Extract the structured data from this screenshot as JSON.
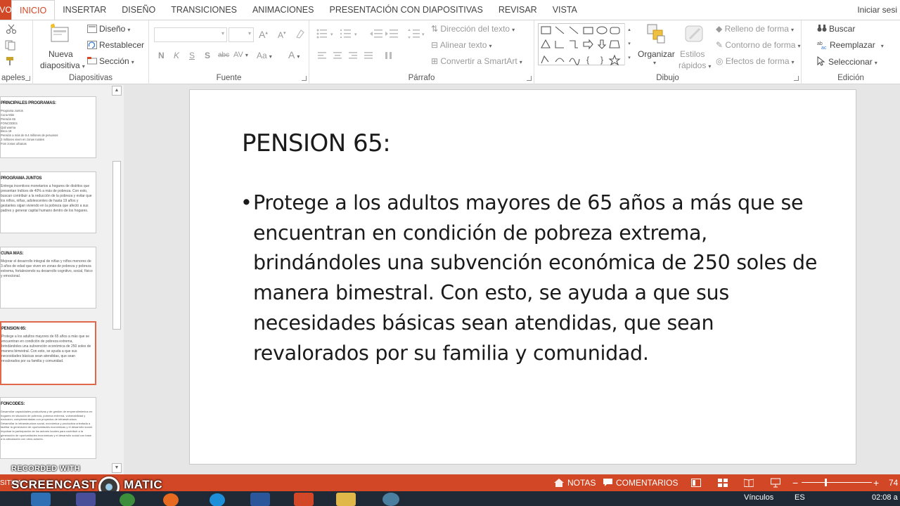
{
  "tabs": {
    "file_label": "VO",
    "items": [
      "INICIO",
      "INSERTAR",
      "DISEÑO",
      "TRANSICIONES",
      "ANIMACIONES",
      "PRESENTACIÓN CON DIAPOSITIVAS",
      "REVISAR",
      "VISTA"
    ],
    "active": "INICIO",
    "signin": "Iniciar sesi"
  },
  "ribbon": {
    "portapapeles": {
      "label": "apeles"
    },
    "diapositivas": {
      "label": "Diapositivas",
      "nueva_line1": "Nueva",
      "nueva_line2": "diapositiva",
      "diseno": "Diseño",
      "restablecer": "Restablecer",
      "seccion": "Sección"
    },
    "fuente": {
      "label": "Fuente",
      "bold": "N",
      "italic": "K",
      "underline": "S",
      "shadow": "S",
      "strike": "abc",
      "spacing": "AV",
      "case": "Aa",
      "color": "A",
      "grow": "A",
      "shrink": "A"
    },
    "parrafo": {
      "label": "Párrafo",
      "direccion": "Dirección del texto",
      "alinear": "Alinear texto",
      "smartart": "Convertir a SmartArt"
    },
    "dibujo": {
      "label": "Dibujo",
      "organizar": "Organizar",
      "estilos1": "Estilos",
      "estilos2": "rápidos",
      "relleno": "Relleno de forma",
      "contorno": "Contorno de forma",
      "efectos": "Efectos de forma"
    },
    "edicion": {
      "label": "Edición",
      "buscar": "Buscar",
      "reemplazar": "Reemplazar",
      "seleccionar": "Seleccionar"
    }
  },
  "thumbnails": [
    {
      "title": "PRINCIPALES PROGRAMAS:",
      "body": "Programa Juntos\nCuna Más\nPensión 65\nFONCODES\nQali warma\nBeca 18\nPensión a más de 9.4 millones de peruanos\n2 millones viven en zonas rurales\nFoni zonas urbanas"
    },
    {
      "title": "PROGRAMA JUNTOS",
      "body": "Entrega incentivos monetarios a hogares de distritos que presentan índices de 40% a más de pobreza. Con esto, buscan contribuir a la reducción de la pobreza y evitar que los niños, niñas, adolescentes de hasta 19 años y gestantes sigan viviendo en la pobreza que afectó a sus padres y generar capital humano dentro de los hogares."
    },
    {
      "title": "CUNA MAS:",
      "body": "Mejorar el desarrollo integral de niñas y niños menores de 3 años de edad que viven en zonas de pobreza y pobreza extrema, fortaleciendo su desarrollo cognitivo, social, físico y emocional."
    },
    {
      "title": "PENSION 65:",
      "body": "Protege a los adultos mayores de 65 años a más que se encuentran en condición de pobreza extrema, brindándoles una subvención económica de 250 soles de manera bimestral. Con esto, se ayuda a que sus necesidades básicas sean atendidas, que sean revalorados por su familia y comunidad."
    },
    {
      "title": "FONCODES:",
      "body": "Desarrollar capacidades productivas y de gestión de emprendimientos en hogares en situación de pobreza, pobreza extrema, vulnerabilidad y exclusión; complementadas con proyectos de infraestructura.\nDesarrollar la infraestructura social, económica y productiva orientada a facilitar la generación de oportunidades económicas y el desarrollo social.\nImpulsar la participación de los actores locales para contribuir a la generación de oportunidades económicas y el desarrollo social con base a la articulación con otros actores."
    }
  ],
  "slide": {
    "title": "PENSION 65:",
    "bullet": "Protege a los adultos mayores de 65 años a más que se encuentran en condición de pobreza extrema, brindándoles una subvención económica de 250 soles de manera bimestral. Con esto, se ayuda a que sus necesidades básicas sean atendidas, que sean revalorados por su familia y comunidad."
  },
  "statusbar": {
    "left": "SITIVA",
    "notas": "NOTAS",
    "comentarios": "COMENTARIOS",
    "zoom_minus": "−",
    "zoom_plus": "+",
    "zoom": "74"
  },
  "watermark": {
    "line1": "RECORDED WITH",
    "line2": "SCREENCAST",
    "line3": "MATIC"
  },
  "taskbar": {
    "links": "Vínculos",
    "lang": "ES",
    "time": "02:08 a"
  },
  "colors": {
    "accent": "#d24726",
    "thumb_selected": "#e0674a"
  }
}
